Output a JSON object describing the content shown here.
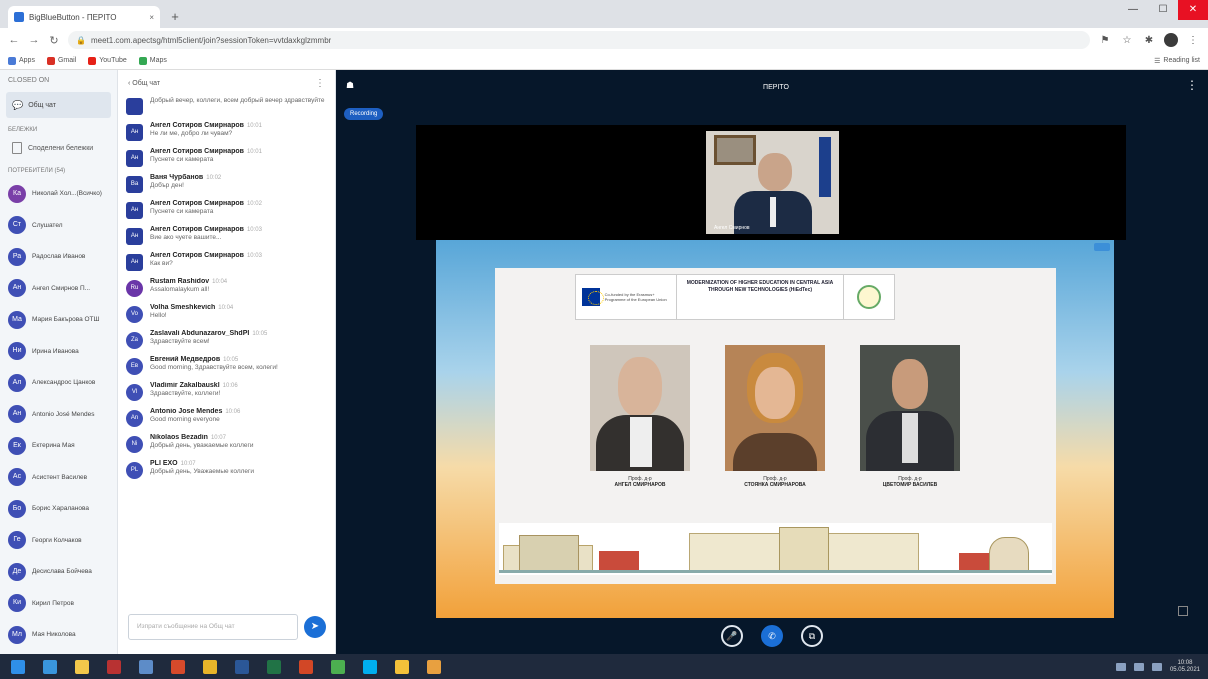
{
  "browser": {
    "tab_title": "BigBlueButton - ΠΕΡΙΤΟ",
    "tab_close": "×",
    "new_tab": "+",
    "url": "meet1.com.apectsg/html5client/join?sessionToken=vvtdaxkglzmmbr",
    "lock_icon": "lock-icon",
    "bookmarks": [
      {
        "label": "Apps",
        "color": "#4a7ad6"
      },
      {
        "label": "Gmail",
        "color": "#d93025"
      },
      {
        "label": "YouTube",
        "color": "#e62117"
      },
      {
        "label": "Maps",
        "color": "#34a853"
      }
    ],
    "reading_list": "Reading list"
  },
  "users_panel": {
    "header": "CLOSED ON",
    "public_chat": "Общ чат",
    "notes_section": "БЕЛЕЖКИ",
    "shared_notes": "Споделени бележки",
    "users_section": "ПОТРЕБИТЕЛИ (54)",
    "users": [
      {
        "initials": "Ка",
        "name": "Николай Хол...(Всичко)",
        "color": "#7a3fa8",
        "status": "#d9342b"
      },
      {
        "initials": "Ст",
        "name": "Слушател",
        "color": "#3f4fb5",
        "status": ""
      },
      {
        "initials": "Ра",
        "name": "Радослав Иванов",
        "color": "#3f4fb5",
        "status": "#2a9d56"
      },
      {
        "initials": "Ан",
        "name": "Ангел Смирнов П...",
        "color": "#3f4fb5",
        "status": "#d9342b"
      },
      {
        "initials": "Ма",
        "name": "Мария Бакърова ОТШ",
        "color": "#3f4fb5",
        "status": "#2a9d56"
      },
      {
        "initials": "Ни",
        "name": "Ирина Иванова",
        "color": "#3f4fb5",
        "status": "#d9342b"
      },
      {
        "initials": "Ал",
        "name": "Александрос Цанков",
        "color": "#3f4fb5",
        "status": "#2a9d56"
      },
      {
        "initials": "Ан",
        "name": "Antonio José Mendes",
        "color": "#3f4fb5",
        "status": "#d9342b"
      },
      {
        "initials": "Ек",
        "name": "Ектерина Мая",
        "color": "#3f4fb5",
        "status": "#2a9d56"
      },
      {
        "initials": "Ас",
        "name": "Асистент Василев",
        "color": "#3f4fb5",
        "status": "#d9342b"
      },
      {
        "initials": "Бо",
        "name": "Борис Хараланова",
        "color": "#3f4fb5",
        "status": "#2a9d56"
      },
      {
        "initials": "Ге",
        "name": "Георги Колчаков",
        "color": "#3f4fb5",
        "status": "#d9342b"
      },
      {
        "initials": "Де",
        "name": "Десислава Бойчева",
        "color": "#3f4fb5",
        "status": "#2a9d56"
      },
      {
        "initials": "Ки",
        "name": "Кирил Петров",
        "color": "#3f4fb5",
        "status": "#d9342b"
      },
      {
        "initials": "Мл",
        "name": "Мая Николова",
        "color": "#3f4fb5",
        "status": ""
      }
    ]
  },
  "chat": {
    "title": "‹ Общ чат",
    "menu_icon": "⋮",
    "messages": [
      {
        "initials": "",
        "name": "",
        "time": "",
        "text": "Добрый вечер, коллеги, всем добрый вечер здравствуйте",
        "avatar": "#2a3e9c",
        "circle": false
      },
      {
        "initials": "Ан",
        "name": "Ангел Сотиров Смирнаров",
        "time": "10:01",
        "text": "Не ли ме, добро ли чувам?",
        "avatar": "#2a3e9c",
        "circle": false
      },
      {
        "initials": "Ан",
        "name": "Ангел Сотиров Смирнаров",
        "time": "10:01",
        "text": "Пуснете си камерата",
        "avatar": "#2a3e9c",
        "circle": false
      },
      {
        "initials": "Ва",
        "name": "Ваня Чурбанов",
        "time": "10:02",
        "text": "Добър ден!",
        "avatar": "#2a3e9c",
        "circle": false
      },
      {
        "initials": "Ан",
        "name": "Ангел Сотиров Смирнаров",
        "time": "10:02",
        "text": "Пуснете си камерата",
        "avatar": "#2a3e9c",
        "circle": false
      },
      {
        "initials": "Ан",
        "name": "Ангел Сотиров Смирнаров",
        "time": "10:03",
        "text": "Вие ако чуете вашите...",
        "avatar": "#2a3e9c",
        "circle": false
      },
      {
        "initials": "Ан",
        "name": "Ангел Сотиров Смирнаров",
        "time": "10:03",
        "text": "Как ви?",
        "avatar": "#2a3e9c",
        "circle": false
      },
      {
        "initials": "Ru",
        "name": "Rustam Rashidov",
        "time": "10:04",
        "text": "Assalomalaykum all!",
        "avatar": "#6a35a8",
        "circle": true
      },
      {
        "initials": "Vo",
        "name": "Volha Smeshkevich",
        "time": "10:04",
        "text": "Hello!",
        "avatar": "#3f4fb5",
        "circle": true
      },
      {
        "initials": "Za",
        "name": "Zaslavali Abdunazarov_ShdPI",
        "time": "10:05",
        "text": "Здравствуйте всем!",
        "avatar": "#3f4fb5",
        "circle": true
      },
      {
        "initials": "Ев",
        "name": "Евгений Медведров",
        "time": "10:05",
        "text": "Good morning, Здравствуйте всем, колеги!",
        "avatar": "#3f4fb5",
        "circle": true
      },
      {
        "initials": "Vl",
        "name": "Vladimir Zakalbauskl",
        "time": "10:06",
        "text": "Здравствуйте, коллеги!",
        "avatar": "#3f4fb5",
        "circle": true
      },
      {
        "initials": "An",
        "name": "Antonio Jose Mendes",
        "time": "10:06",
        "text": "Good morning everyone",
        "avatar": "#3f4fb5",
        "circle": true
      },
      {
        "initials": "Ni",
        "name": "Nikolaos Bezadin",
        "time": "10:07",
        "text": "Добрый день, уважаемые коллеги",
        "avatar": "#3f4fb5",
        "circle": true
      },
      {
        "initials": "PL",
        "name": "PLI EXO",
        "time": "10:07",
        "text": "Добрый день, Уважаемые коллеги",
        "avatar": "#3f4fb5",
        "circle": true
      }
    ],
    "compose_placeholder": "Изпрати съобщение на Общ чат",
    "send_icon": "➤"
  },
  "stage": {
    "meeting_title": "ΠΕΡΙΤΟ",
    "record_badge": "Recording",
    "cam_caption": "Ангел Смирнов",
    "slide": {
      "eu_text": "Co-funded by the Erasmus+ Programme of the European Union",
      "project_title": "MODERNIZATION OF HIGHER EDUCATION IN CENTRAL ASIA THROUGH NEW TECHNOLOGIES (HiEdTec)",
      "people": [
        {
          "title": "Проф. д-р",
          "name": "АНГЕЛ СМИРНАРОВ"
        },
        {
          "title": "Проф. д-р",
          "name": "СТОЯНКА СМИРНАРОВА"
        },
        {
          "title": "Проф. д-р",
          "name": "ЦВЕТОМИР ВАСИЛЕВ"
        }
      ]
    },
    "controls": [
      "mic-icon",
      "phone-icon",
      "screen-share-icon"
    ]
  },
  "taskbar": {
    "time": "10:08",
    "date": "05.05.2021",
    "apps": [
      {
        "name": "windows-start-icon",
        "color": "#2f8fe8"
      },
      {
        "name": "edge-icon",
        "color": "#3a96dd"
      },
      {
        "name": "explorer-icon",
        "color": "#f2c84b"
      },
      {
        "name": "mail-icon",
        "color": "#b83232"
      },
      {
        "name": "photos-icon",
        "color": "#5d8cc8"
      },
      {
        "name": "media-icon",
        "color": "#d64a2b"
      },
      {
        "name": "chrome-icon",
        "color": "#e8b52a"
      },
      {
        "name": "word-icon",
        "color": "#2b5797"
      },
      {
        "name": "excel-icon",
        "color": "#217346"
      },
      {
        "name": "powerpoint-icon",
        "color": "#d24726"
      },
      {
        "name": "chrome-icon-2",
        "color": "#4caf50"
      },
      {
        "name": "skype-icon",
        "color": "#00aff0"
      },
      {
        "name": "folder-icon",
        "color": "#f3c13a"
      },
      {
        "name": "paint-icon",
        "color": "#e8a040"
      }
    ]
  }
}
